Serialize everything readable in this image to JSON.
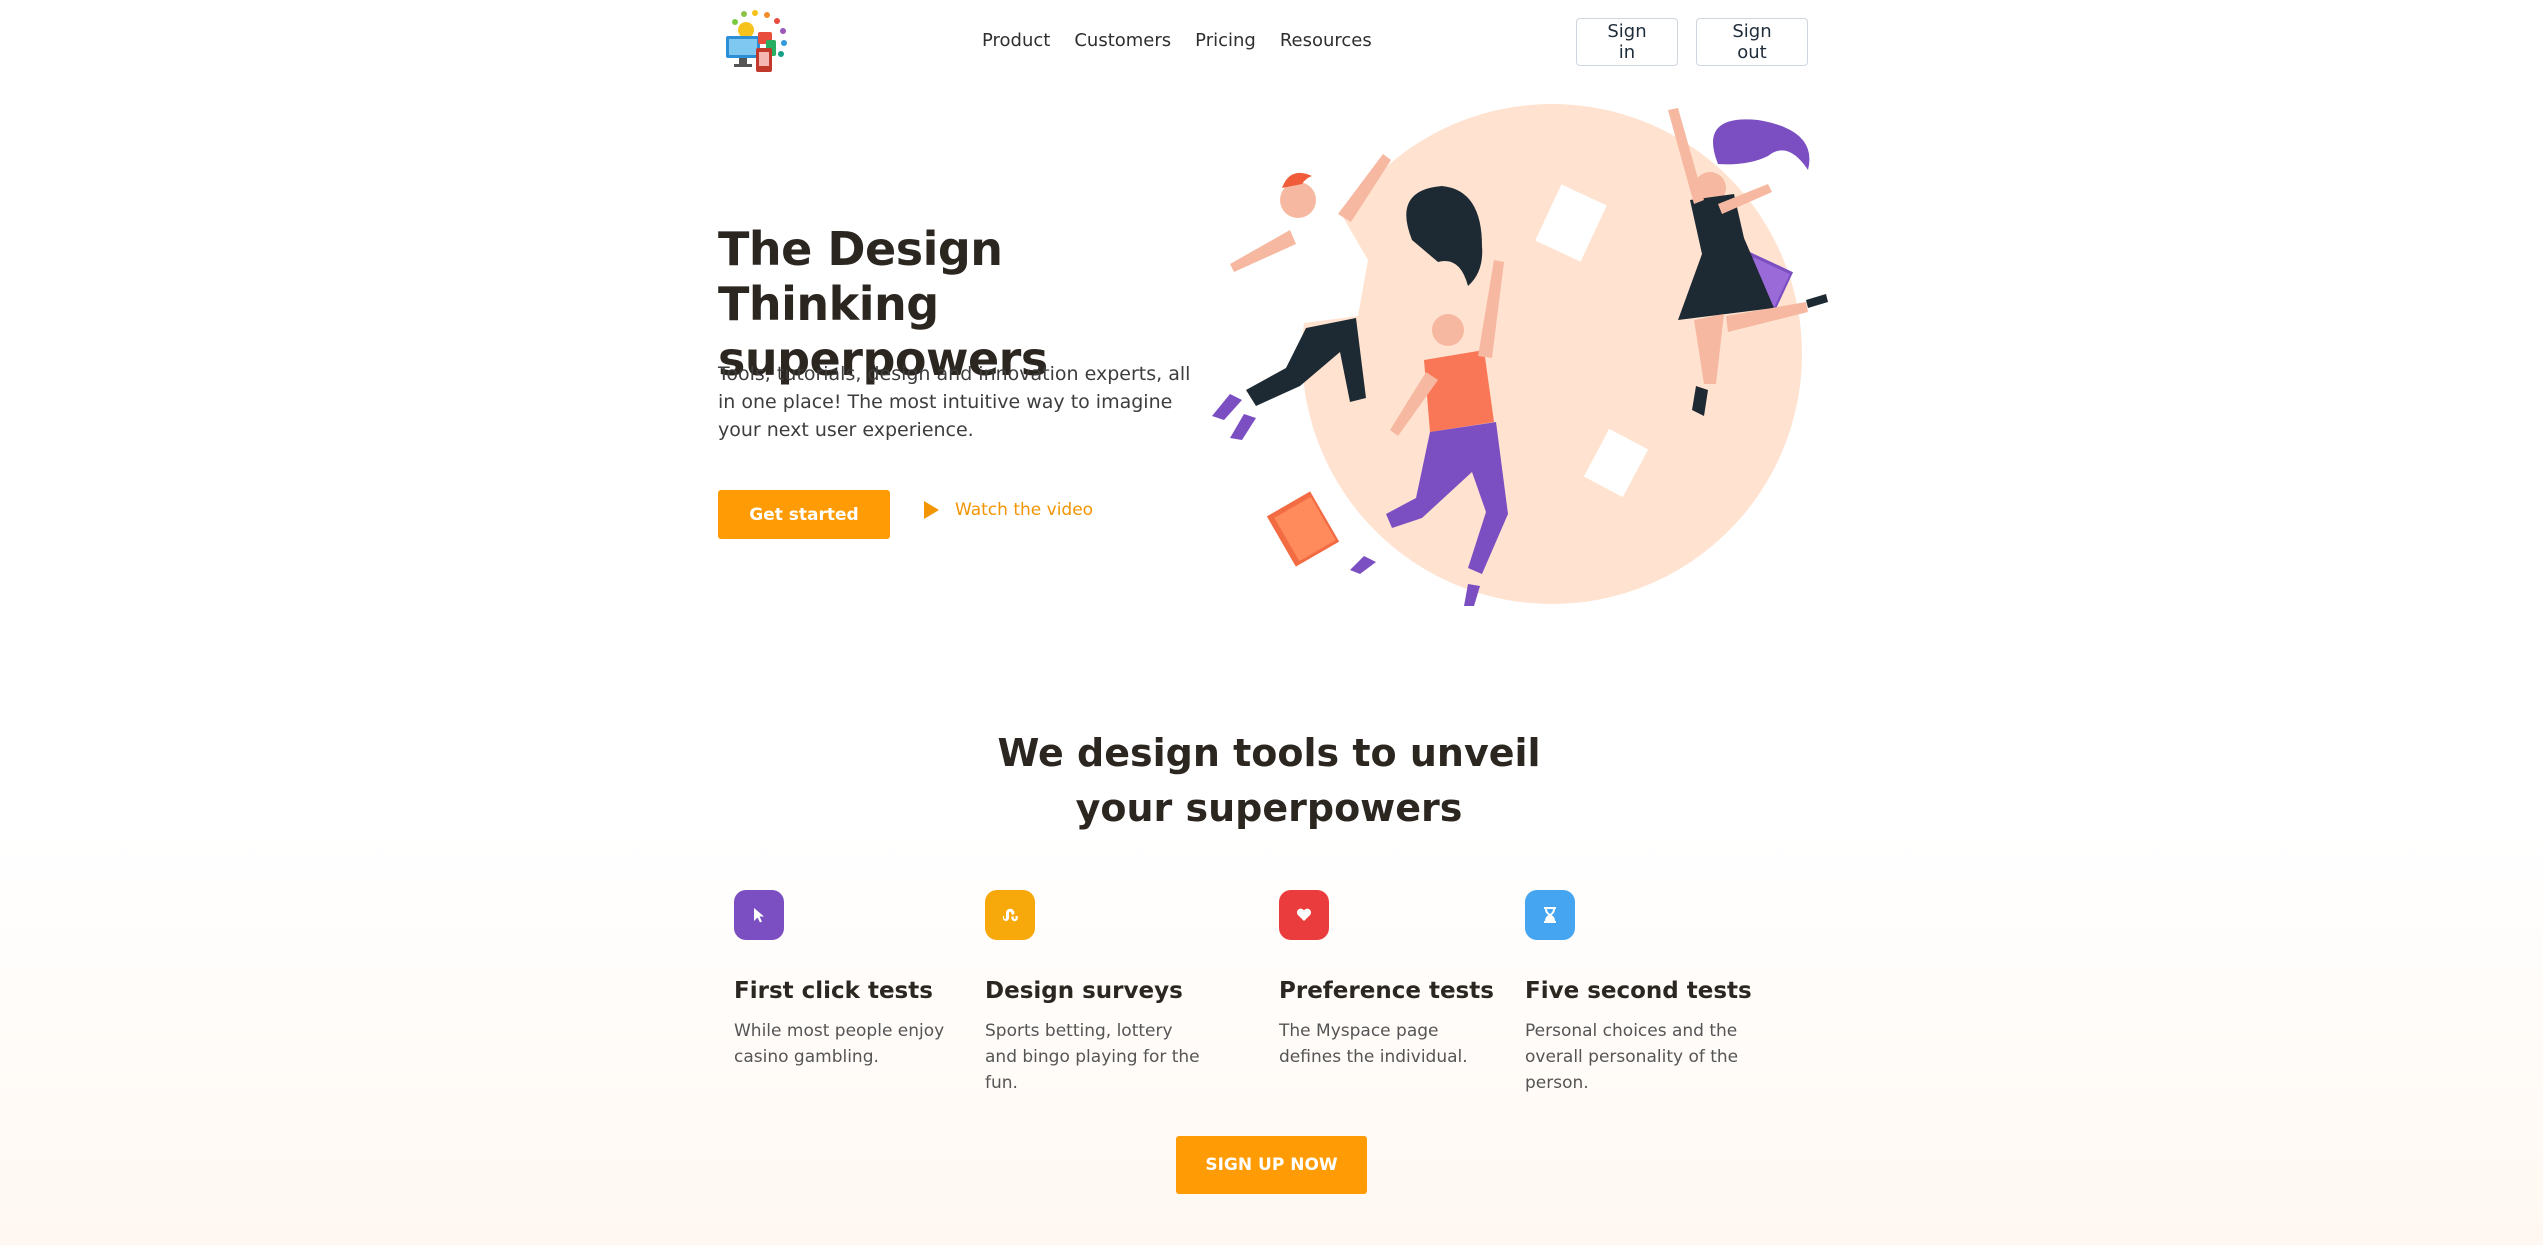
{
  "header": {
    "nav": [
      "Product",
      "Customers",
      "Pricing",
      "Resources"
    ],
    "sign_in": "Sign in",
    "sign_out": "Sign out"
  },
  "hero": {
    "title_line1": "The Design Thinking",
    "title_line2": "superpowers",
    "text": "Tools, tutorials, design and innovation experts, all in one place! The most intuitive way to imagine your next user experience.",
    "cta": "Get started",
    "video_link": "Watch the video"
  },
  "features": {
    "title_line1": "We design tools to unveil",
    "title_line2": "your superpowers",
    "items": [
      {
        "icon": "cursor-icon",
        "color": "#7b4fc1",
        "title": "First click tests",
        "text": "While most people enjoy casino gambling."
      },
      {
        "icon": "stumbleupon-icon",
        "color": "#f7a80b",
        "title": "Design surveys",
        "text": "Sports betting, lottery and bingo playing for the fun."
      },
      {
        "icon": "heart-icon",
        "color": "#ea3c3c",
        "title": "Preference tests",
        "text": "The Myspace page defines the individual."
      },
      {
        "icon": "hourglass-icon",
        "color": "#45a5f0",
        "title": "Five second tests",
        "text": "Personal choices and the overall personality of the person."
      }
    ],
    "cta": "SIGN UP NOW"
  },
  "colors": {
    "accent": "#ff9b05",
    "circle": "#ffe3d0"
  }
}
